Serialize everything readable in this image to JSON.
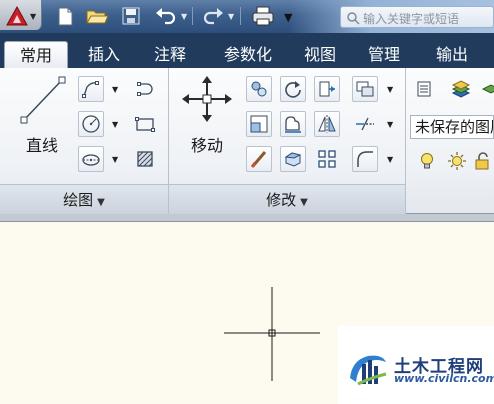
{
  "quick_access": {
    "app_icon": "autocad-app-icon",
    "buttons": [
      "new-file-icon",
      "open-folder-icon",
      "save-icon",
      "undo-icon",
      "redo-icon",
      "plot-printer-icon"
    ],
    "search_placeholder": "输入关键字或短语"
  },
  "tabs": [
    {
      "label": "常用",
      "active": true
    },
    {
      "label": "插入"
    },
    {
      "label": "注释"
    },
    {
      "label": "参数化"
    },
    {
      "label": "视图"
    },
    {
      "label": "管理"
    },
    {
      "label": "输出"
    }
  ],
  "panels": {
    "draw": {
      "title": "绘图",
      "line_label": "直线",
      "tools": [
        "polyline-icon",
        "circle-icon",
        "ellipse-icon",
        "arc-icon",
        "rectangle-icon",
        "hatch-icon"
      ]
    },
    "modify": {
      "title": "修改",
      "move_label": "移动",
      "tools": [
        "copy-icon",
        "rotate-icon",
        "trim-icon",
        "scale-icon",
        "stretch-icon",
        "mirror-icon",
        "erase-icon",
        "explode-icon",
        "array-icon",
        "fillet-icon",
        "offset-icon",
        "layer-icon"
      ]
    },
    "layers": {
      "current_layer": "未保存的图层状态"
    }
  },
  "watermark": {
    "title": "土木工程网",
    "url": "www.civilcn.com"
  },
  "colors": {
    "tab_bar": "#203b5c",
    "canvas": "#fdfaf0",
    "watermark_blue": "#1f3f7a"
  }
}
